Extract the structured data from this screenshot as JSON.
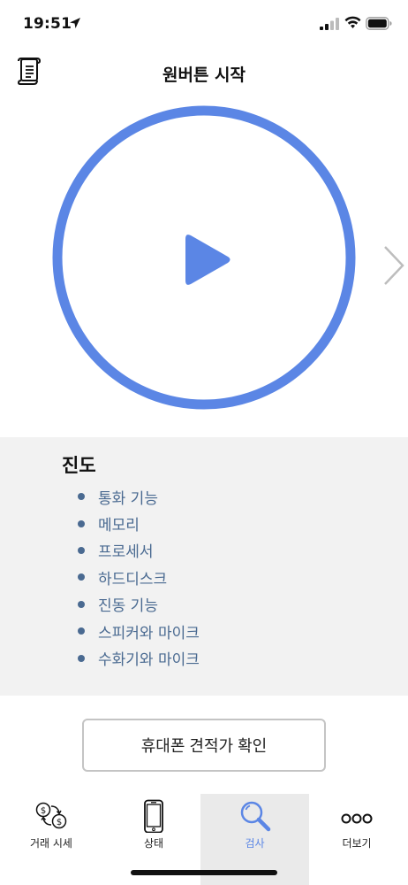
{
  "status_bar": {
    "time": "19:51"
  },
  "nav": {
    "title": "원버튼 시작"
  },
  "colors": {
    "accent": "#5b86e5",
    "list_text": "#4a6a91",
    "panel_bg": "#f2f2f2",
    "tab_active_bg": "#eaeaea"
  },
  "progress": {
    "title": "진도",
    "items": [
      "통화 기능",
      "메모리",
      "프로세서",
      "하드디스크",
      "진동 기능",
      "스피커와 마이크",
      "수화기와 마이크"
    ]
  },
  "price_button": {
    "label": "휴대폰 견적가 확인"
  },
  "tabs": [
    {
      "label": "거래 시세",
      "icon": "dollar-exchange-icon"
    },
    {
      "label": "상태",
      "icon": "phone-icon"
    },
    {
      "label": "검사",
      "icon": "search-icon",
      "active": true
    },
    {
      "label": "더보기",
      "icon": "more-icon"
    }
  ]
}
